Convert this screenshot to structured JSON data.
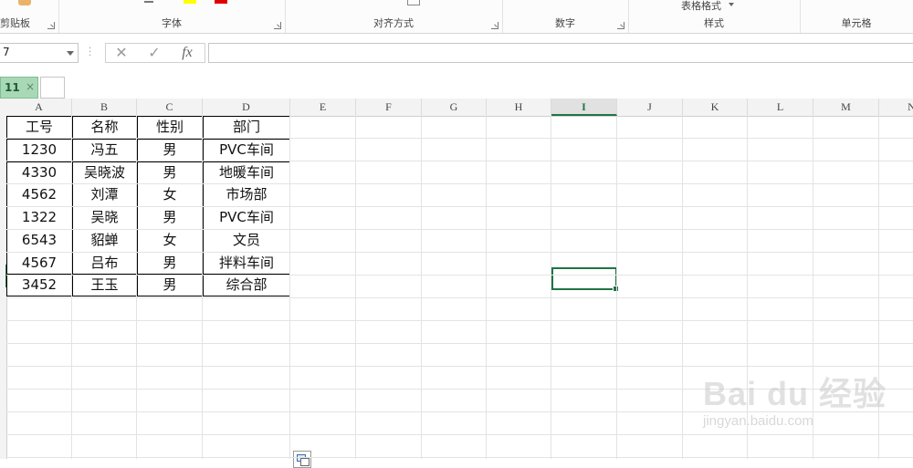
{
  "ribbon": {
    "groups": [
      {
        "label": "剪贴板"
      },
      {
        "label": "字体"
      },
      {
        "label": "对齐方式"
      },
      {
        "label": "数字"
      },
      {
        "label": "样式"
      },
      {
        "label": "单元格"
      }
    ],
    "table_format_label": "表格格式"
  },
  "formula_bar": {
    "name_box": "7",
    "cancel_icon": "✕",
    "enter_icon": "✓",
    "fx_label": "fx",
    "formula": ""
  },
  "sheet_tabs": {
    "active_tab": "11",
    "close_glyph": "×"
  },
  "columns": [
    "A",
    "B",
    "C",
    "D",
    "E",
    "F",
    "G",
    "H",
    "I",
    "J",
    "K",
    "L",
    "M",
    "N"
  ],
  "active_column": "I",
  "table": {
    "headers": [
      "工号",
      "名称",
      "性别",
      "部门"
    ],
    "rows": [
      [
        "1230",
        "冯五",
        "男",
        "PVC车间"
      ],
      [
        "4330",
        "吴晓波",
        "男",
        "地暖车间"
      ],
      [
        "4562",
        "刘潭",
        "女",
        "市场部"
      ],
      [
        "1322",
        "吴晓",
        "男",
        "PVC车间"
      ],
      [
        "6543",
        "貂蝉",
        "女",
        "文员"
      ],
      [
        "4567",
        "吕布",
        "男",
        "拌料车间"
      ],
      [
        "3452",
        "王玉",
        "男",
        "综合部"
      ]
    ]
  },
  "watermark": {
    "logo": "Bai du 经验",
    "url": "jingyan.baidu.com"
  },
  "colors": {
    "accent": "#217346",
    "sheet_tab_bg": "#a9d8b7"
  }
}
